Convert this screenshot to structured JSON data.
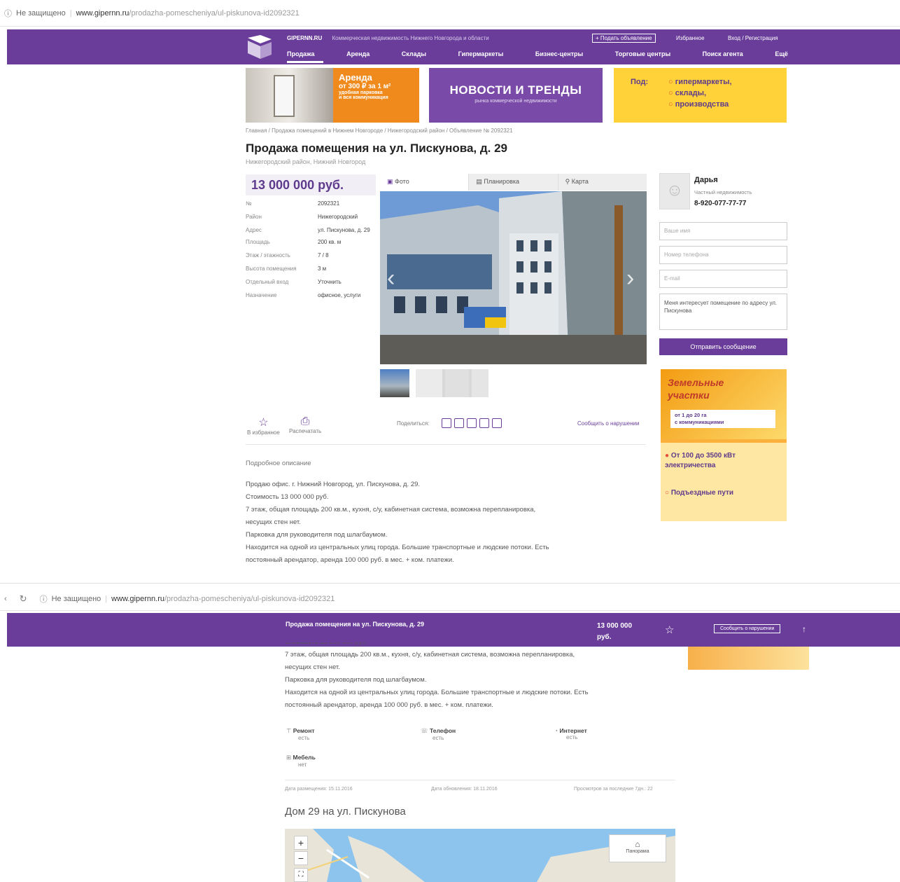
{
  "browser1": {
    "security": "Не защищено",
    "domain": "www.gipernn.ru",
    "path": "/prodazha-pomescheniya/ul-piskunova-id2092321"
  },
  "header": {
    "site_name": "GIPERNN.RU",
    "tagline": "Коммерческая недвижимость Нижнего Новгорода и области",
    "add_ad": "+ Подать объявление",
    "favorites": "Избранное",
    "login": "Вход / Регистрация",
    "nav": [
      "Продажа",
      "Аренда",
      "Склады",
      "Гипермаркеты",
      "Бизнес-центры",
      "Торговые центры",
      "Поиск агента",
      "Ещё"
    ]
  },
  "banners": {
    "b1_lines": [
      "Аренда",
      "от 300 ₽ за 1 м²",
      "удобная парковка",
      "и вся коммуникация"
    ],
    "b2_title": "НОВОСТИ И ТРЕНДЫ",
    "b2_sub": "рынка коммерческой недвижимости",
    "b3_lead": "Под:",
    "b3_items": [
      "гипермаркеты,",
      "склады,",
      "производства"
    ]
  },
  "breadcrumb": "Главная / Продажа помещений в Нижнем Новгороде / Нижегородский район / Объявление № 2092321",
  "title": "Продажа помещения на ул. Пискунова, д. 29",
  "subtitle": "Нижегородский район, Нижний Новгород",
  "price": "13 000 000 руб.",
  "props": [
    {
      "k": "№",
      "v": "2092321"
    },
    {
      "k": "Район",
      "v": "Нижегородский"
    },
    {
      "k": "Адрес",
      "v": "ул. Пискунова, д. 29"
    },
    {
      "k": "Площадь",
      "v": "200 кв. м"
    },
    {
      "k": "Этаж / этажность",
      "v": "7 / 8"
    },
    {
      "k": "Высота помещения",
      "v": "3 м"
    },
    {
      "k": "Отдельный вход",
      "v": "Уточнить"
    },
    {
      "k": "Назначение",
      "v": "офисное, услуги"
    }
  ],
  "tabs": [
    "Фото",
    "Планировка",
    "Карта"
  ],
  "agent": {
    "name": "Дарья",
    "role": "Частный недвижимость",
    "phone": "8-920-077-77-77"
  },
  "form": {
    "name_ph": "Ваше имя",
    "phone_ph": "Номер телефона",
    "email_ph": "E-mail",
    "message": "Меня интересует помещение по адресу ул. Пискунова",
    "send": "Отправить сообщение"
  },
  "side_ad": {
    "title": "Земельные участки",
    "line1": "от 1 до 20 га",
    "line2": "с коммуникациями",
    "line3": "От 100 до 3500 кВт электричества",
    "line4": "Подъездные пути"
  },
  "actions": {
    "fav": "В избранное",
    "print": "Распечатать",
    "share": "Поделиться:",
    "report": "Сообщить о нарушении"
  },
  "description": {
    "heading": "Подробное описание",
    "lines": [
      "Продаю офис. г. Нижний Новгород, ул. Пискунова, д. 29.",
      "Стоимость 13 000 000 руб.",
      "7 этаж, общая площадь 200 кв.м., кухня, с/у, кабинетная система, возможна перепланировка,",
      "несущих стен нет.",
      "Парковка для руководителя под шлагбаумом.",
      "Находится на одной из центральных улиц города. Большие транспортные и людские потоки. Есть",
      "постоянный арендатор, аренда 100 000 руб. в мес. + ком. платежи."
    ]
  },
  "browser2": {
    "security": "Не защищено",
    "domain": "www.gipernn.ru",
    "path": "/prodazha-pomescheniya/ul-piskunova-id2092321"
  },
  "sticky": {
    "title": "Продажа помещения на ул. Пискунова, д. 29",
    "price_1": "13 000 000",
    "price_2": "руб.",
    "report": "Сообщить о нарушении"
  },
  "desc2_lines": [
    "Стоимость 13 000 000 руб.",
    "7 этаж, общая площадь 200 кв.м., кухня, с/у, кабинетная система, возможна перепланировка,",
    "несущих стен нет.",
    "Парковка для руководителя под шлагбаумом.",
    "Находится на одной из центральных улиц города. Большие транспортные и людские потоки. Есть",
    "постоянный арендатор, аренда 100 000 руб. в мес. + ком. платежи."
  ],
  "features": [
    {
      "k": "Ремонт",
      "v": "есть"
    },
    {
      "k": "Телефон",
      "v": "есть"
    },
    {
      "k": "Интернет",
      "v": "есть"
    },
    {
      "k": "Мебель",
      "v": "нет"
    }
  ],
  "meta": {
    "placed": "Дата размещения: 15.11.2016",
    "updated": "Дата обновления: 18.11.2016",
    "views": "Просмотров за последние 7дн.: 22"
  },
  "map_section": {
    "heading": "Дом 29 на ул. Пискунова",
    "panorama": "Панорама"
  },
  "colors": {
    "brand": "#6a3d9a",
    "accent": "#fbb03b"
  }
}
